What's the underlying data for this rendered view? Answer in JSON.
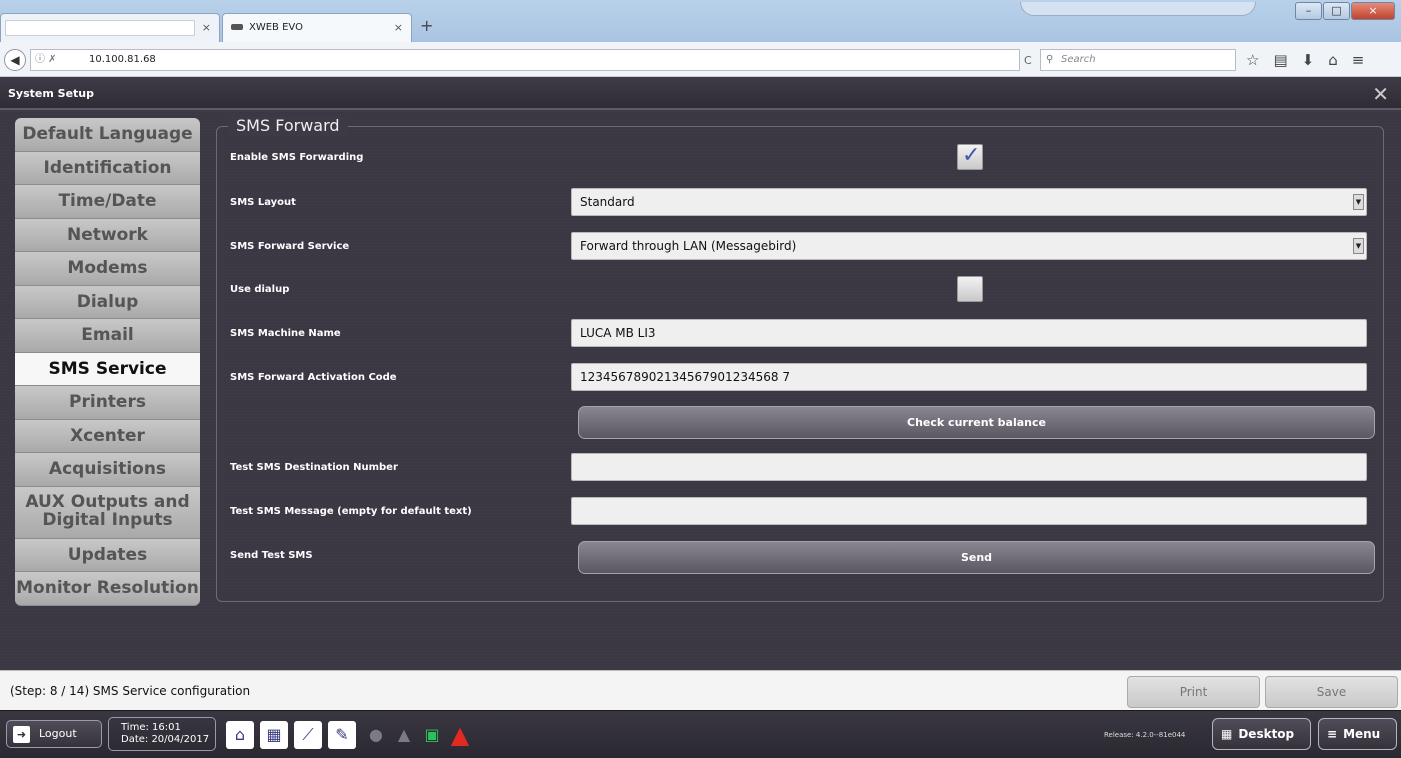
{
  "browser": {
    "tabs": [
      {
        "label": ""
      },
      {
        "label": "XWEB EVO"
      }
    ],
    "url": "10.100.81.68",
    "search_placeholder": "Search"
  },
  "app": {
    "title": "System Setup",
    "sidebar": {
      "items": [
        {
          "label": "Default Language"
        },
        {
          "label": "Identification"
        },
        {
          "label": "Time/Date"
        },
        {
          "label": "Network"
        },
        {
          "label": "Modems"
        },
        {
          "label": "Dialup"
        },
        {
          "label": "Email"
        },
        {
          "label": "SMS Service",
          "active": true
        },
        {
          "label": "Printers"
        },
        {
          "label": "Xcenter"
        },
        {
          "label": "Acquisitions"
        },
        {
          "label": "AUX Outputs and Digital Inputs"
        },
        {
          "label": "Updates"
        },
        {
          "label": "Monitor Resolution"
        }
      ]
    },
    "form": {
      "legend": "SMS Forward",
      "enable_label": "Enable SMS Forwarding",
      "enable_checked": true,
      "layout_label": "SMS Layout",
      "layout_value": "Standard",
      "service_label": "SMS Forward Service",
      "service_value": "Forward through LAN (Messagebird)",
      "dialup_label": "Use dialup",
      "dialup_checked": false,
      "machine_label": "SMS Machine Name",
      "machine_value": "LUCA MB LI3",
      "code_label": "SMS Forward Activation Code",
      "code_value": "12345678902134567901234568 7",
      "balance_button": "Check current balance",
      "test_number_label": "Test SMS Destination Number",
      "test_number_value": "",
      "test_message_label": "Test SMS Message (empty for default text)",
      "test_message_value": "",
      "send_label": "Send Test SMS",
      "send_button": "Send"
    },
    "footer": {
      "step_text": "(Step: 8 / 14) SMS Service configuration",
      "print": "Print",
      "save": "Save"
    },
    "taskbar": {
      "logout": "Logout",
      "time": "Time: 16:01",
      "date": "Date: 20/04/2017",
      "release": "Release: 4.2.0--81e044",
      "desktop": "Desktop",
      "menu": "Menu"
    }
  }
}
